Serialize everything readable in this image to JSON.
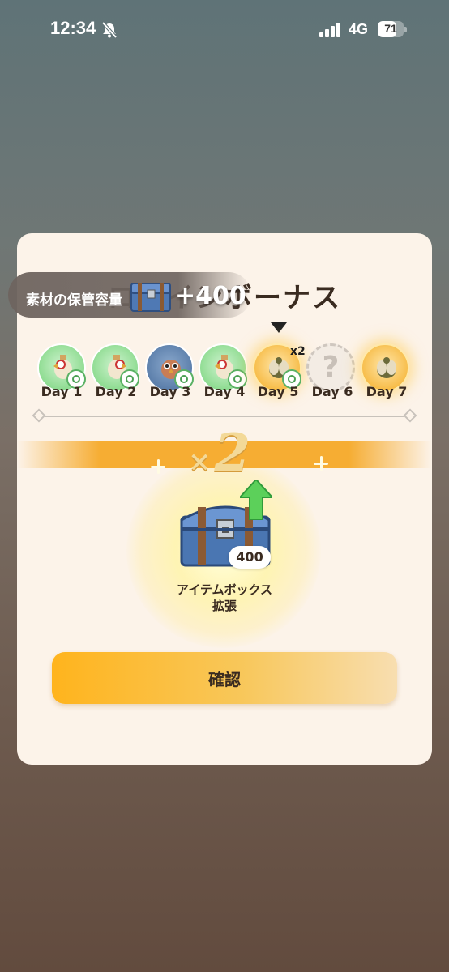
{
  "status_bar": {
    "time": "12:34",
    "network": "4G",
    "battery": "71",
    "battery_level": 0.71
  },
  "dialog": {
    "title": "ログインボーナス",
    "toast": {
      "label": "素材の保管容量",
      "value": "+400"
    },
    "days": [
      {
        "label": "Day 1",
        "state": "claimed-green"
      },
      {
        "label": "Day 2",
        "state": "claimed-green"
      },
      {
        "label": "Day 3",
        "state": "claimed-blue"
      },
      {
        "label": "Day 4",
        "state": "claimed-green"
      },
      {
        "label": "Day 5",
        "state": "current",
        "multiplier": "x2"
      },
      {
        "label": "Day 6",
        "state": "unknown",
        "glyph": "?"
      },
      {
        "label": "Day 7",
        "state": "gold"
      }
    ],
    "bonus_multiplier": {
      "prefix": "×",
      "value": "2"
    },
    "reward": {
      "quantity": "400",
      "name_line1": "アイテムボックス",
      "name_line2": "拡張"
    },
    "confirm_label": "確認"
  },
  "colors": {
    "accent": "#f6ad33",
    "panel": "#fcf3e9",
    "text": "#3a2b20"
  }
}
